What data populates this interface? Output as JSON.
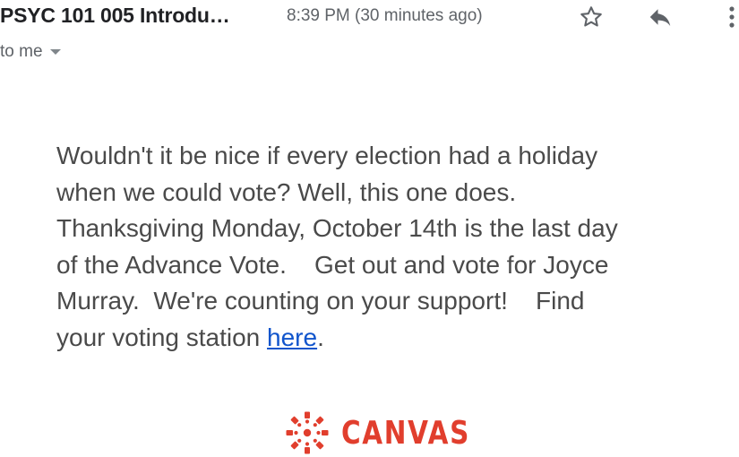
{
  "header": {
    "sender": "PSYC 101 005 Introdu…",
    "time": "8:39 PM (30 minutes ago)",
    "icons": {
      "star": "star-icon",
      "reply": "reply-icon",
      "more": "more-vertical-icon"
    }
  },
  "recipient": {
    "label": "to me",
    "icon": "chevron-down-icon"
  },
  "body": {
    "lines": [
      "Wouldn't it be nice if every election had a holiday",
      "when we could vote? Well, this one does.",
      "Thanksgiving Monday, October 14th is the last day",
      "of the Advance Vote.    Get out and vote for Joyce",
      "Murray.  We're counting on your support!    Find"
    ],
    "last_line_prefix": "your voting station ",
    "link_text": "here",
    "last_line_suffix": "."
  },
  "footer": {
    "logo_text": "CANVAS",
    "logo_icon": "canvas-logo-icon",
    "brand_color": "#e13e2d"
  },
  "colors": {
    "text": "#4a4a4a",
    "link": "#1155cc",
    "meta": "#5f6368"
  }
}
